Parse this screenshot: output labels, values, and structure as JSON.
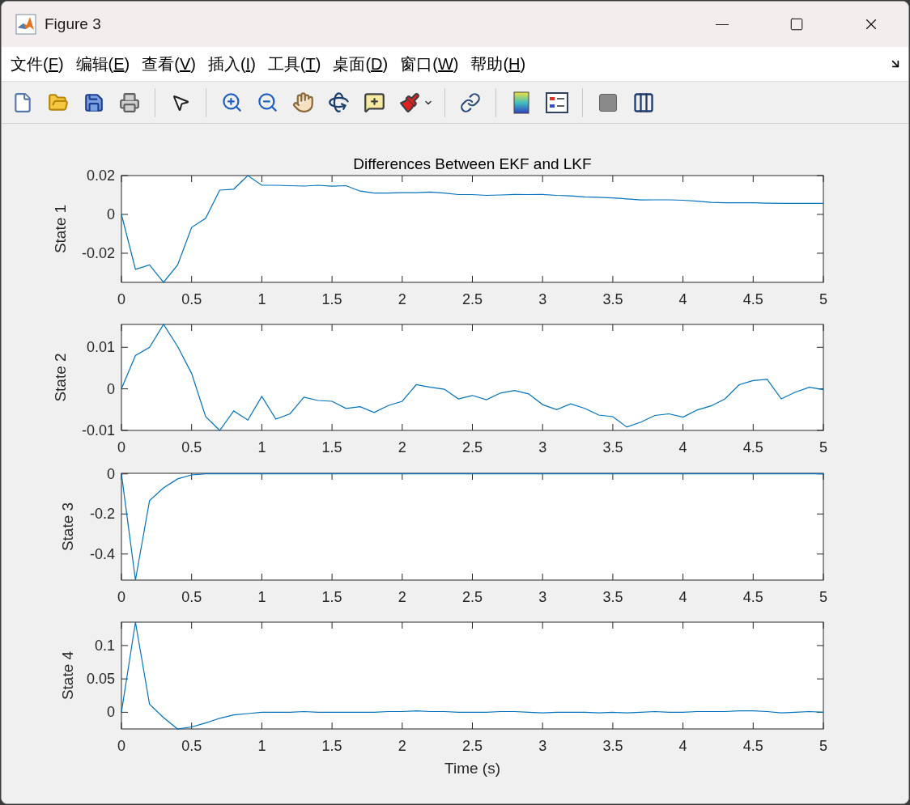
{
  "window": {
    "title": "Figure 3"
  },
  "menu": [
    {
      "text": "文件(",
      "underlined": "F",
      "rest": ")"
    },
    {
      "text": "编辑(",
      "underlined": "E",
      "rest": ")"
    },
    {
      "text": "查看(",
      "underlined": "V",
      "rest": ")"
    },
    {
      "text": "插入(",
      "underlined": "I",
      "rest": ")"
    },
    {
      "text": "工具(",
      "underlined": "T",
      "rest": ")"
    },
    {
      "text": "桌面(",
      "underlined": "D",
      "rest": ")"
    },
    {
      "text": "窗口(",
      "underlined": "W",
      "rest": ")"
    },
    {
      "text": "帮助(",
      "underlined": "H",
      "rest": ")"
    }
  ],
  "figure": {
    "subplots": [
      {
        "chart_data": {
          "type": "line",
          "title": "Differences Between EKF and LKF",
          "ylabel": "State 1",
          "x": [
            0,
            0.1,
            0.2,
            0.3,
            0.4,
            0.5,
            0.6,
            0.7,
            0.8,
            0.9,
            1,
            1.1,
            1.2,
            1.3,
            1.4,
            1.5,
            1.6,
            1.7,
            1.8,
            1.9,
            2,
            2.1,
            2.2,
            2.3,
            2.4,
            2.5,
            2.6,
            2.7,
            2.8,
            2.9,
            3,
            3.1,
            3.2,
            3.3,
            3.4,
            3.5,
            3.6,
            3.7,
            3.8,
            3.9,
            4,
            4.1,
            4.2,
            4.3,
            4.4,
            4.5,
            4.6,
            4.7,
            4.8,
            4.9,
            5
          ],
          "series": [
            {
              "color": "#0072bd",
              "values": [
                0,
                -0.0283,
                -0.026,
                -0.035,
                -0.026,
                -0.0067,
                -0.002,
                0.0125,
                0.013,
                0.02,
                0.015,
                0.015,
                0.0148,
                0.0146,
                0.015,
                0.0145,
                0.0148,
                0.012,
                0.011,
                0.011,
                0.0112,
                0.0112,
                0.0115,
                0.011,
                0.0102,
                0.0102,
                0.0098,
                0.01,
                0.0103,
                0.0102,
                0.0103,
                0.0098,
                0.0095,
                0.009,
                0.0088,
                0.0085,
                0.008,
                0.0074,
                0.0075,
                0.0075,
                0.0073,
                0.0068,
                0.0062,
                0.006,
                0.006,
                0.006,
                0.0058,
                0.0057,
                0.0057,
                0.0057,
                0.0057
              ]
            }
          ],
          "xlim": [
            0,
            5
          ],
          "ylim": [
            -0.035,
            0.02
          ],
          "xticks": [
            0,
            0.5,
            1,
            1.5,
            2,
            2.5,
            3,
            3.5,
            4,
            4.5,
            5
          ],
          "yticks": [
            -0.02,
            0,
            0.02
          ]
        }
      },
      {
        "chart_data": {
          "type": "line",
          "ylabel": "State 2",
          "x": [
            0,
            0.1,
            0.2,
            0.3,
            0.4,
            0.5,
            0.6,
            0.7,
            0.8,
            0.9,
            1,
            1.1,
            1.2,
            1.3,
            1.4,
            1.5,
            1.6,
            1.7,
            1.8,
            1.9,
            2,
            2.1,
            2.2,
            2.3,
            2.4,
            2.5,
            2.6,
            2.7,
            2.8,
            2.9,
            3,
            3.1,
            3.2,
            3.3,
            3.4,
            3.5,
            3.6,
            3.7,
            3.8,
            3.9,
            4,
            4.1,
            4.2,
            4.3,
            4.4,
            4.5,
            4.6,
            4.7,
            4.8,
            4.9,
            5
          ],
          "series": [
            {
              "color": "#0072bd",
              "values": [
                0,
                0.008,
                0.01,
                0.0155,
                0.0102,
                0.0037,
                -0.0067,
                -0.01,
                -0.0053,
                -0.0075,
                -0.0018,
                -0.0073,
                -0.006,
                -0.002,
                -0.0028,
                -0.003,
                -0.0047,
                -0.0043,
                -0.0057,
                -0.004,
                -0.003,
                0.001,
                0.0004,
                -0.0001,
                -0.0024,
                -0.0016,
                -0.0026,
                -0.001,
                -0.0004,
                -0.0012,
                -0.0038,
                -0.005,
                -0.0036,
                -0.0047,
                -0.0063,
                -0.0067,
                -0.0092,
                -0.008,
                -0.0064,
                -0.006,
                -0.0068,
                -0.0051,
                -0.0041,
                -0.0024,
                0.001,
                0.002,
                0.0023,
                -0.0024,
                -0.0008,
                0.0004,
                -0.0002
              ]
            }
          ],
          "xlim": [
            0,
            5
          ],
          "ylim": [
            -0.01,
            0.0155
          ],
          "xticks": [
            0,
            0.5,
            1,
            1.5,
            2,
            2.5,
            3,
            3.5,
            4,
            4.5,
            5
          ],
          "yticks": [
            -0.01,
            0,
            0.01
          ]
        }
      },
      {
        "chart_data": {
          "type": "line",
          "ylabel": "State 3",
          "x": [
            0,
            0.1,
            0.2,
            0.3,
            0.4,
            0.5,
            0.6,
            0.7,
            0.8,
            0.9,
            1,
            1.1,
            1.2,
            1.3,
            1.4,
            1.5,
            1.6,
            1.7,
            1.8,
            1.9,
            2,
            2.1,
            2.2,
            2.3,
            2.4,
            2.5,
            2.6,
            2.7,
            2.8,
            2.9,
            3,
            3.1,
            3.2,
            3.3,
            3.4,
            3.5,
            3.6,
            3.7,
            3.8,
            3.9,
            4,
            4.1,
            4.2,
            4.3,
            4.4,
            4.5,
            4.6,
            4.7,
            4.8,
            4.9,
            5
          ],
          "series": [
            {
              "color": "#0072bd",
              "values": [
                0,
                -0.53,
                -0.133,
                -0.07,
                -0.025,
                -0.005,
                0,
                0,
                0,
                0,
                0,
                0,
                0,
                0,
                0,
                0,
                0,
                0,
                0,
                0,
                0,
                0,
                0,
                0,
                0,
                0,
                0,
                0,
                0,
                0,
                0,
                0,
                0,
                0,
                0,
                0,
                0,
                0,
                0,
                0,
                0,
                0,
                0,
                0,
                0,
                0,
                0,
                0,
                0,
                0,
                0
              ]
            }
          ],
          "xlim": [
            0,
            5
          ],
          "ylim": [
            -0.53,
            0.003
          ],
          "xticks": [
            0,
            0.5,
            1,
            1.5,
            2,
            2.5,
            3,
            3.5,
            4,
            4.5,
            5
          ],
          "yticks": [
            -0.4,
            -0.2,
            0
          ]
        }
      },
      {
        "chart_data": {
          "type": "line",
          "xlabel": "Time (s)",
          "ylabel": "State 4",
          "x": [
            0,
            0.1,
            0.2,
            0.3,
            0.4,
            0.5,
            0.6,
            0.7,
            0.8,
            0.9,
            1,
            1.1,
            1.2,
            1.3,
            1.4,
            1.5,
            1.6,
            1.7,
            1.8,
            1.9,
            2,
            2.1,
            2.2,
            2.3,
            2.4,
            2.5,
            2.6,
            2.7,
            2.8,
            2.9,
            3,
            3.1,
            3.2,
            3.3,
            3.4,
            3.5,
            3.6,
            3.7,
            3.8,
            3.9,
            4,
            4.1,
            4.2,
            4.3,
            4.4,
            4.5,
            4.6,
            4.7,
            4.8,
            4.9,
            5
          ],
          "series": [
            {
              "color": "#0072bd",
              "values": [
                0,
                0.135,
                0.012,
                -0.008,
                -0.025,
                -0.022,
                -0.016,
                -0.009,
                -0.004,
                -0.002,
                0,
                0,
                0,
                0.001,
                0,
                0,
                0,
                0,
                0,
                0.001,
                0.001,
                0.002,
                0.001,
                0.001,
                0,
                0,
                0,
                0.001,
                0.001,
                0,
                -0.001,
                0,
                0,
                0,
                -0.001,
                0,
                -0.001,
                0,
                0.001,
                0,
                0,
                0.001,
                0.001,
                0.001,
                0.002,
                0.002,
                0.001,
                -0.001,
                0,
                0.001,
                0
              ]
            }
          ],
          "xlim": [
            0,
            5
          ],
          "ylim": [
            -0.025,
            0.135
          ],
          "xticks": [
            0,
            0.5,
            1,
            1.5,
            2,
            2.5,
            3,
            3.5,
            4,
            4.5,
            5
          ],
          "yticks": [
            0,
            0.05,
            0.1
          ]
        }
      }
    ]
  }
}
